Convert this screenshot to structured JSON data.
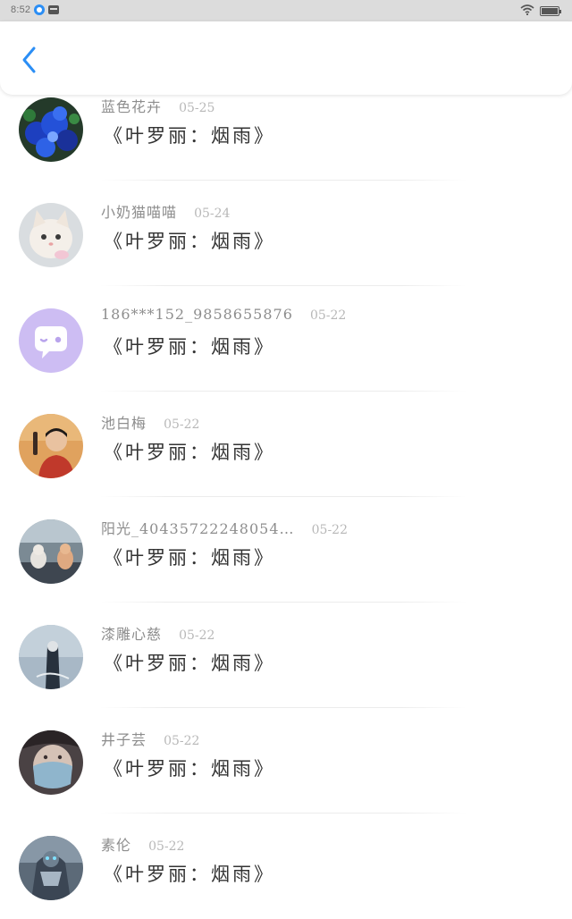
{
  "status_bar": {
    "time": "8:52"
  },
  "comments": [
    {
      "username": "蓝色花卉",
      "date": "05-25",
      "text": "《叶罗丽：烟雨》"
    },
    {
      "username": "小奶猫喵喵",
      "date": "05-24",
      "text": "《叶罗丽：烟雨》"
    },
    {
      "username": "186***152_9858655876",
      "date": "05-22",
      "text": "《叶罗丽：烟雨》"
    },
    {
      "username": "池白梅",
      "date": "05-22",
      "text": "《叶罗丽：烟雨》"
    },
    {
      "username": "阳光_40435722248054…",
      "date": "05-22",
      "text": "《叶罗丽：烟雨》"
    },
    {
      "username": "漆雕心慈",
      "date": "05-22",
      "text": "《叶罗丽：烟雨》"
    },
    {
      "username": "井子芸",
      "date": "05-22",
      "text": "《叶罗丽：烟雨》"
    },
    {
      "username": "素伦",
      "date": "05-22",
      "text": "《叶罗丽：烟雨》"
    }
  ],
  "icons": {
    "back": "chevron-left-icon",
    "notification": "message-circle-icon",
    "mail": "mail-icon",
    "wifi": "wifi-icon",
    "battery": "battery-icon"
  },
  "colors": {
    "accent": "#2b8ef5",
    "status_bar_bg": "#dcdcdc",
    "username": "#8d8d8d",
    "date": "#b8b8b8",
    "comment_text": "#333333"
  }
}
